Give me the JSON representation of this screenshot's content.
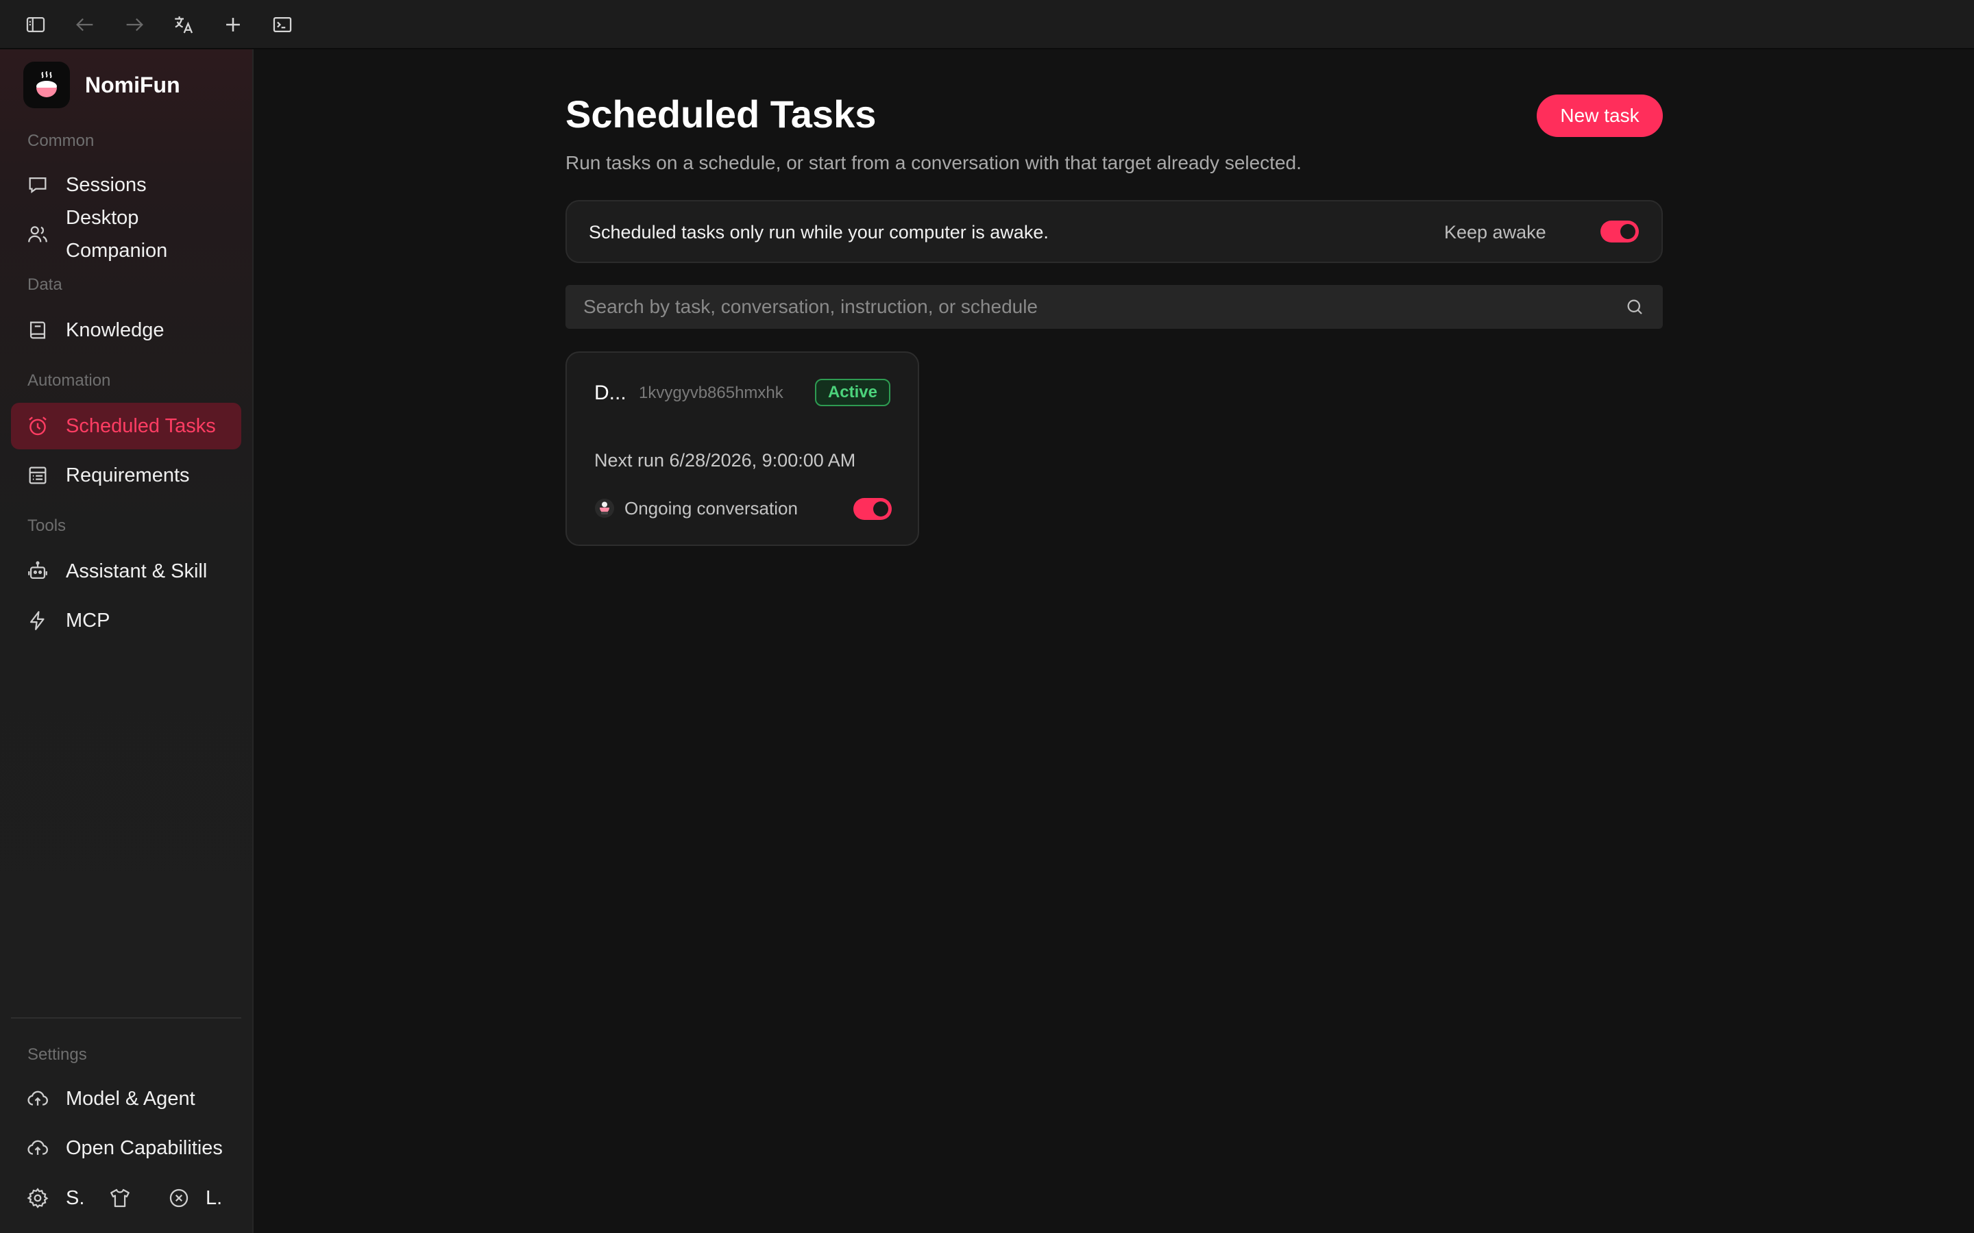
{
  "brand": {
    "name": "NomiFun"
  },
  "sidebar": {
    "sections": {
      "common": "Common",
      "data": "Data",
      "automation": "Automation",
      "tools": "Tools",
      "settings": "Settings"
    },
    "items": {
      "sessions": "Sessions",
      "desktop_companion_line1": "Desktop",
      "desktop_companion_line2": "Companion",
      "knowledge": "Knowledge",
      "scheduled_tasks": "Scheduled Tasks",
      "requirements": "Requirements",
      "assistant_skill": "Assistant & Skill",
      "mcp": "MCP",
      "model_agent": "Model & Agent",
      "open_capabilities": "Open Capabilities"
    },
    "bottom": {
      "settings_short": "S.",
      "logout_short": "L."
    }
  },
  "main": {
    "title": "Scheduled Tasks",
    "subtitle": "Run tasks on a schedule, or start from a conversation with that target already selected.",
    "new_task_label": "New task",
    "notice": {
      "text": "Scheduled tasks only run while your computer is awake.",
      "keep_awake_label": "Keep awake",
      "keep_awake_on": true
    },
    "search": {
      "placeholder": "Search by task, conversation, instruction, or schedule",
      "value": ""
    },
    "tasks": [
      {
        "title": "D...",
        "id": "1kvygyvb865hmxhk",
        "status": "Active",
        "next_run": "Next run 6/28/2026, 9:00:00 AM",
        "conversation": "Ongoing conversation",
        "enabled": true
      }
    ]
  },
  "colors": {
    "accent": "#ff2e5b",
    "active_nav_bg": "#5a1824",
    "status_active": "#4cd37c",
    "background": "#121212"
  }
}
